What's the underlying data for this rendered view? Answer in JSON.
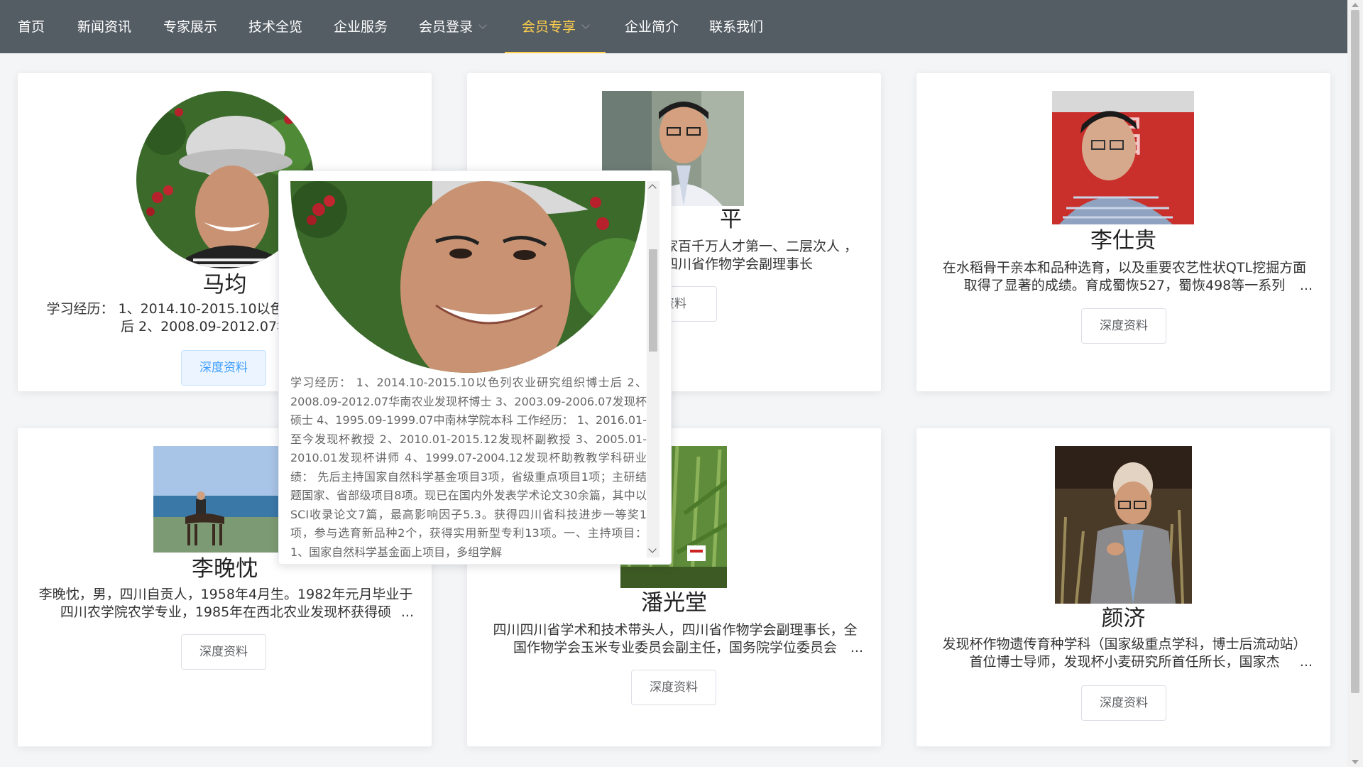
{
  "nav": {
    "items": [
      {
        "label": "首页"
      },
      {
        "label": "新闻资讯"
      },
      {
        "label": "专家展示"
      },
      {
        "label": "技术全览"
      },
      {
        "label": "企业服务"
      },
      {
        "label": "会员登录"
      },
      {
        "label": "会员专享"
      },
      {
        "label": "企业简介"
      },
      {
        "label": "联系我们"
      }
    ]
  },
  "experts": [
    {
      "name": "马均",
      "desc": "学习经历： 1、2014.10-2015.10以色列农业研究组织博士后 2、2008.09-2012.07华南农业",
      "button": "深度资料"
    },
    {
      "name": "平",
      "desc": "家百千万人才第一、二层次人 ，四川省作物学会副理事长",
      "button": "资料"
    },
    {
      "name": "李仕贵",
      "desc": "在水稻骨干亲本和品种选育，以及重要农艺性状QTL挖掘方面取得了显著的成绩。育成蜀恢527，蜀恢498等一系列",
      "button": "深度资料"
    },
    {
      "name": "李晚忱",
      "desc": "李晚忱，男，四川自贡人，1958年4月生。1982年元月毕业于四川农学院农学专业，1985年在西北农业发现杯获得硕",
      "button": "深度资料"
    },
    {
      "name": "潘光堂",
      "desc": "四川四川省学术和技术带头人，四川省作物学会副理事长，全国作物学会玉米专业委员会副主任，国务院学位委员会",
      "button": "深度资料"
    },
    {
      "name": "颜济",
      "desc": "发现杯作物遗传育种学科（国家级重点学科，博士后流动站）首位博士导师，发现杯小麦研究所首任所长，国家杰",
      "button": "深度资料"
    }
  ],
  "ellipsis": "...",
  "popover": {
    "text": "学习经历： 1、2014.10-2015.10以色列农业研究组织博士后 2、2008.09-2012.07华南农业发现杯博士 3、2003.09-2006.07发现杯硕士 4、1995.09-1999.07中南林学院本科 工作经历： 1、2016.01-至今发现杯教授 2、2010.01-2015.12发现杯副教授 3、2005.01-2010.01发现杯讲师 4、1999.07-2004.12发现杯助教教学科研业绩： 先后主持国家自然科学基金项目3项，省级重点项目1项；主研结题国家、省部级项目8项。现已在国内外发表学术论文30余篇，其中以SCI收录论文7篇，最高影响因子5.3。获得四川省科技进步一等奖1项，参与选育新品种2个，获得实用新型专利13项。一、主持项目： 1、国家自然科学基金面上项目，多组学解"
  },
  "colors": {
    "nav_bg": "#545c64",
    "nav_active": "#ffd04b",
    "link_blue": "#409eff"
  }
}
